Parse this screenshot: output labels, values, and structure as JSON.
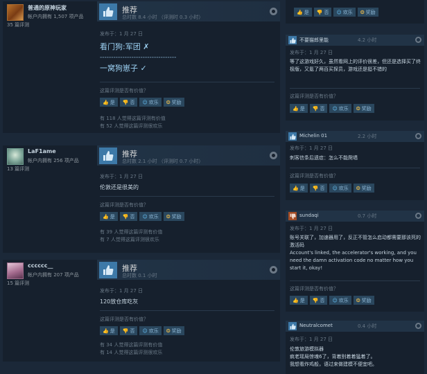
{
  "votes": {
    "yes": "是",
    "no": "否",
    "funny": "欢乐",
    "award": "奖励"
  },
  "helpful_question": "这篇评测是否有价值？",
  "reviews": [
    {
      "author": "普通的原神玩家",
      "games": "帐户内拥有 1,507 项产品",
      "review_count": "35 篇评测",
      "recommendation": "推荐",
      "hours": "总时数 8.4 小时 （评测时 0.3 小时）",
      "posted": "发布于：1 月 27 日",
      "lines": [
        "看门狗:军团 ✗",
        "----------------------------------",
        "一窝狗崽子 ✓"
      ],
      "helpful": "有 118 人觉得这篇评测有价值",
      "funny": "有 52 人觉得这篇评测很欢乐"
    },
    {
      "author": "LaF1ame",
      "games": "帐户内拥有 256 项产品",
      "review_count": "13 篇评测",
      "recommendation": "推荐",
      "hours": "总时数 2.1 小时 （评测时 0.7 小时）",
      "posted": "发布于：1 月 27 日",
      "lines": [
        "伦敦还是很美的"
      ],
      "helpful": "有 39 人觉得这篇评测有价值",
      "funny": "有 7 人觉得这篇评测很欢乐"
    },
    {
      "author": "cccccc__",
      "games": "帐户内拥有 207 项产品",
      "review_count": "15 篇评测",
      "recommendation": "推荐",
      "hours": "总时数 0.1 小时",
      "posted": "发布于：1 月 27 日",
      "lines": [
        "120放仓库吃灰"
      ],
      "helpful": "有 34 人觉得这篇评测有价值",
      "funny": "有 14 人觉得这篇评测很欢乐"
    }
  ],
  "side": [
    {
      "name": "不要猫郎里能",
      "hours": "4.2 小时",
      "positive": true,
      "posted": "发布于：1 月 27 日",
      "text": "等了这游戏好久，虽然看网上的评价很差，但还是选择买了终极版，又氪了两百买探员，游戏还是挺不错的"
    },
    {
      "name": "Michelin 01",
      "hours": "2.2 小时",
      "positive": true,
      "posted": "发布于：1 月 27 日",
      "text": "刺客信条后遗症：怎么不能爬墙"
    },
    {
      "name": "sundaqi",
      "hours": "0.7 小时",
      "positive": false,
      "posted": "发布于：1 月 27 日",
      "text": "账号关联了，加速器用了，反正不管怎么启动都需要那该死的激活码\nAccount's linked, the accelerator's working, and you need the damn activation code no matter how you start it, okay!"
    },
    {
      "name": "Neutralcomet",
      "hours": "0.4 小时",
      "positive": true,
      "posted": "发布于：1 月 27 日",
      "text": "伦敦旅游模拟器\n疯老瑶局惊魂6了，背着别着着猛着了。\n我想看炸鸡般，语过来做建模不便宜吧。"
    }
  ]
}
